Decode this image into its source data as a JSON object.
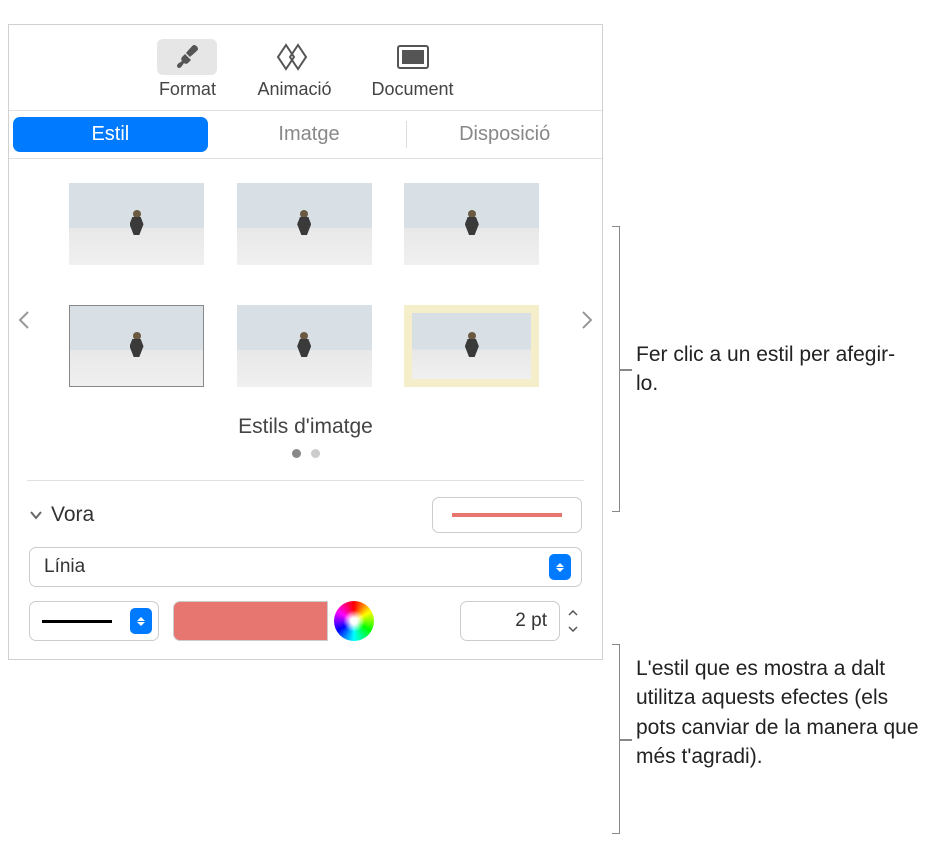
{
  "toolbar": {
    "format": "Format",
    "animacio": "Animació",
    "document": "Document"
  },
  "tabs": {
    "estil": "Estil",
    "imatge": "Imatge",
    "disposicio": "Disposició"
  },
  "styleGrid": {
    "title": "Estils d'imatge"
  },
  "border": {
    "title": "Vora",
    "type": "Línia",
    "width": "2 pt",
    "color": "#e77570"
  },
  "callouts": {
    "styles": "Fer clic a un estil per afegir-lo.",
    "effects": "L'estil que es mostra a dalt utilitza aquests efectes (els pots canviar de la manera que més t'agradi)."
  }
}
